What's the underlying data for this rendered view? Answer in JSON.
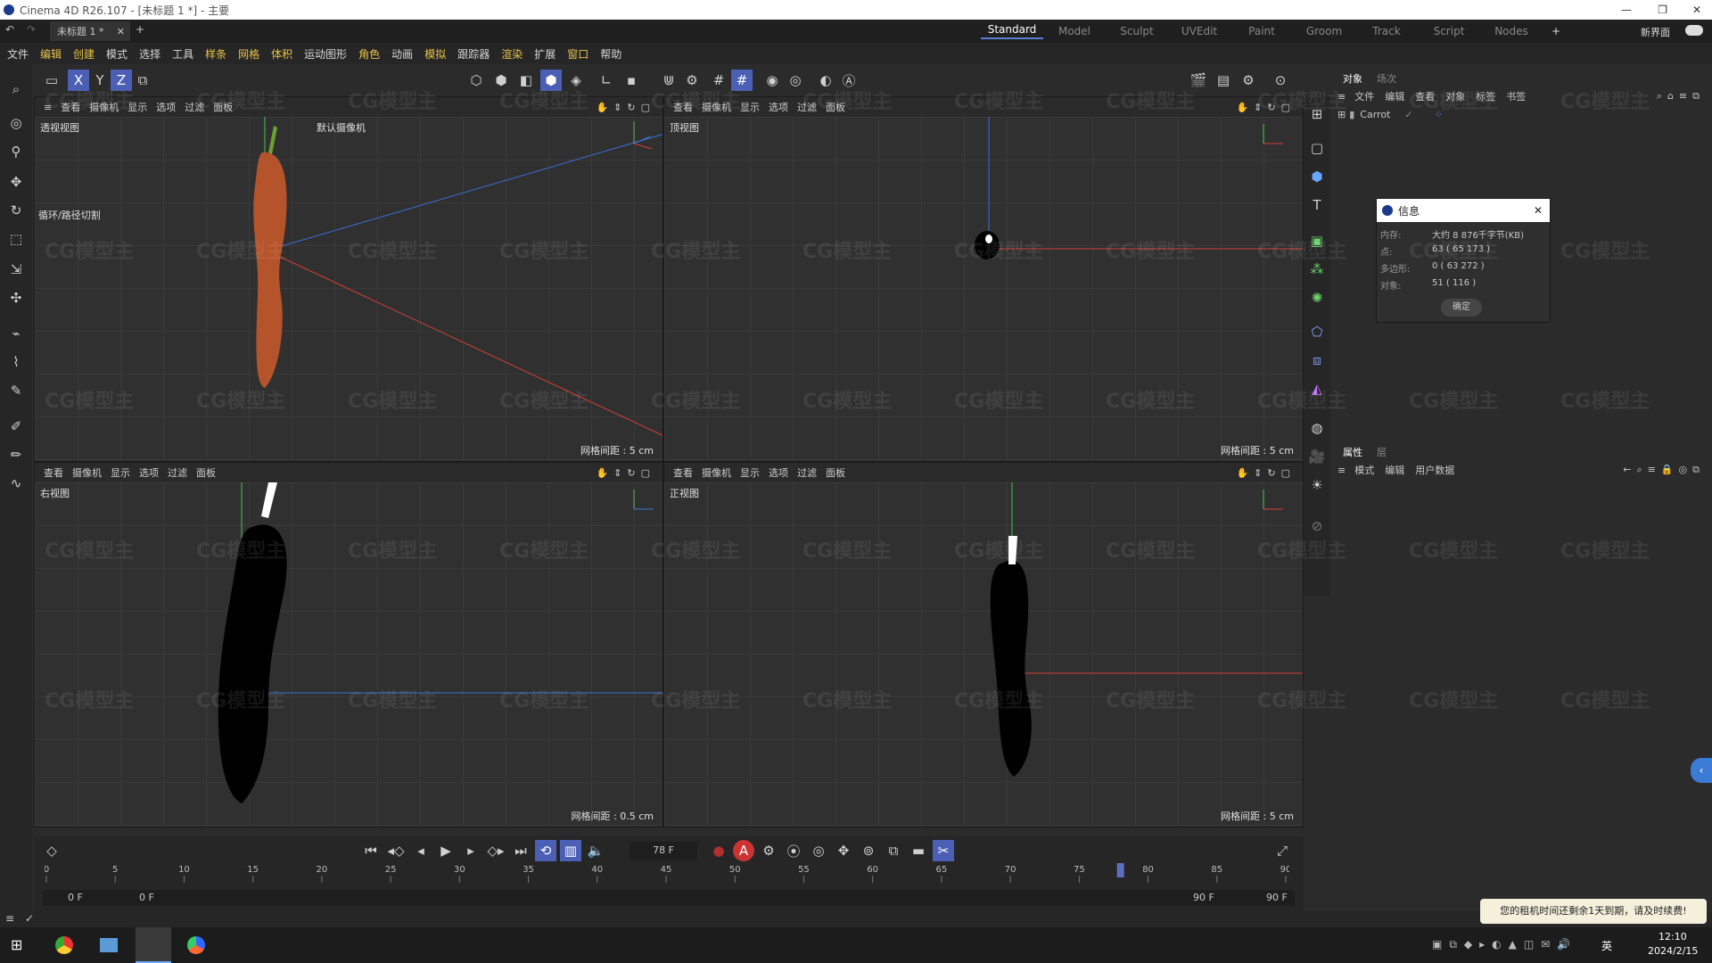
{
  "window": {
    "title": "Cinema 4D R26.107 - [未标题 1 *] - 主要"
  },
  "doc_tab": {
    "label": "未标题 1 *"
  },
  "layouts": [
    "Standard",
    "Model",
    "Sculpt",
    "UVEdit",
    "Paint",
    "Groom",
    "Track",
    "Script",
    "Nodes"
  ],
  "new_ui_label": "新界面",
  "menu": [
    "文件",
    "编辑",
    "创建",
    "模式",
    "选择",
    "工具",
    "样条",
    "网格",
    "体积",
    "运动图形",
    "角色",
    "动画",
    "模拟",
    "跟踪器",
    "渲染",
    "扩展",
    "窗口",
    "帮助"
  ],
  "viewport_menu": [
    "查看",
    "摄像机",
    "显示",
    "选项",
    "过滤",
    "面板"
  ],
  "viewports": {
    "perspective": {
      "name": "透视视图",
      "camera": "默认摄像机",
      "tool": "循环/路径切割",
      "grid": "网格间距 : 5 cm"
    },
    "top": {
      "name": "顶视图",
      "grid": "网格间距 : 5 cm"
    },
    "right": {
      "name": "右视图",
      "grid": "网格间距 : 0.5 cm"
    },
    "front": {
      "name": "正视图",
      "grid": "网格间距 : 5 cm"
    }
  },
  "object_panel": {
    "tabs": [
      "对象",
      "场次"
    ],
    "menu": [
      "文件",
      "编辑",
      "查看",
      "对象",
      "标签",
      "书签"
    ],
    "object": "Carrot"
  },
  "info_dialog": {
    "title": "信息",
    "rows": [
      {
        "label": "内存:",
        "value": "大约 8 876千字节(KB)"
      },
      {
        "label": "点:",
        "value": "63 ( 65 173 )"
      },
      {
        "label": "多边形:",
        "value": "0 ( 63 272 )"
      },
      {
        "label": "对象:",
        "value": "51 ( 116 )"
      }
    ],
    "ok": "确定"
  },
  "attr_panel": {
    "tabs": [
      "属性",
      "层"
    ],
    "menu": [
      "模式",
      "编辑",
      "用户数据"
    ]
  },
  "timeline": {
    "frame": "78 F",
    "ticks": [
      "0",
      "5",
      "10",
      "15",
      "20",
      "25",
      "30",
      "35",
      "40",
      "45",
      "50",
      "55",
      "60",
      "65",
      "70",
      "75",
      "80",
      "85",
      "90"
    ],
    "current": "78",
    "start": "0 F",
    "start2": "0 F",
    "end": "90 F",
    "end2": "90 F"
  },
  "notification": "您的租机时间还剩余1天到期，请及时续费!",
  "tray": {
    "time": "12:10",
    "date": "2024/2/15",
    "ime": "英"
  },
  "watermark": "CG模型主",
  "colors": {
    "accent": "#5a7fd6",
    "axis_x": "#d0403a",
    "axis_y": "#4dc14d",
    "axis_z": "#3b6fd6"
  }
}
